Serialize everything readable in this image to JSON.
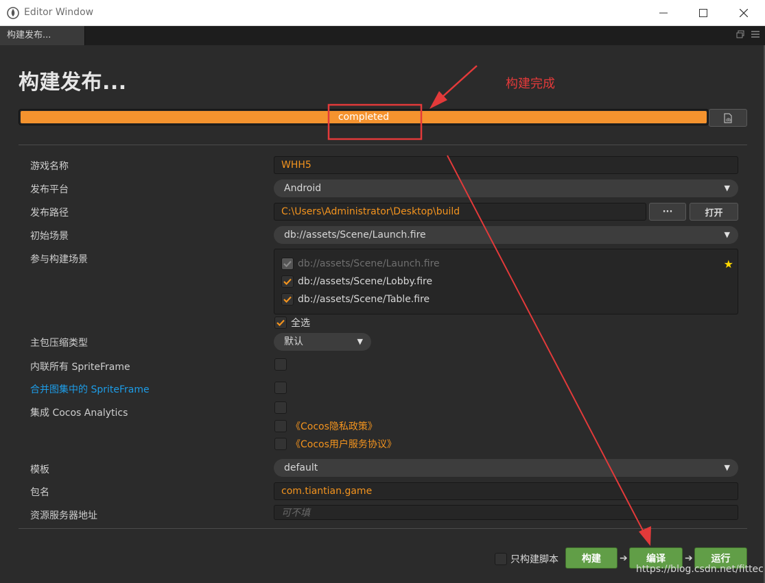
{
  "window": {
    "title": "Editor Window"
  },
  "tab": {
    "label": "构建发布..."
  },
  "page": {
    "heading": "构建发布...",
    "annotation": "构建完成"
  },
  "progress": {
    "label": "completed",
    "percent": 100,
    "color": "#f5932e"
  },
  "form": {
    "game_name": {
      "label": "游戏名称",
      "value": "WHH5"
    },
    "platform": {
      "label": "发布平台",
      "value": "Android"
    },
    "build_path": {
      "label": "发布路径",
      "value": "C:\\Users\\Administrator\\Desktop\\build",
      "browse_label": "···",
      "open_label": "打开"
    },
    "start_scene": {
      "label": "初始场景",
      "value": "db://assets/Scene/Launch.fire"
    },
    "scenes": {
      "label": "参与构建场景",
      "items": [
        {
          "path": "db://assets/Scene/Launch.fire",
          "checked": true,
          "disabled": true
        },
        {
          "path": "db://assets/Scene/Lobby.fire",
          "checked": true,
          "disabled": false
        },
        {
          "path": "db://assets/Scene/Table.fire",
          "checked": true,
          "disabled": false
        }
      ],
      "select_all_label": "全选"
    },
    "compression": {
      "label": "主包压缩类型",
      "value": "默认"
    },
    "inline_spriteframe": {
      "label": "内联所有 SpriteFrame",
      "checked": false
    },
    "merge_spriteframe": {
      "label": "合并图集中的 SpriteFrame",
      "checked": false
    },
    "cocos_analytics": {
      "label": "集成 Cocos Analytics",
      "checked": false,
      "privacy_link": "《Cocos隐私政策》",
      "terms_link": "《Cocos用户服务协议》"
    },
    "template": {
      "label": "模板",
      "value": "default"
    },
    "package_name": {
      "label": "包名",
      "value": "com.tiantian.game"
    },
    "asset_server": {
      "label": "资源服务器地址",
      "placeholder": "可不填"
    }
  },
  "footer": {
    "only_script_label": "只构建脚本",
    "build_label": "构建",
    "compile_label": "编译",
    "run_label": "运行",
    "watermark": "https://blog.csdn.net/fittec"
  },
  "colors": {
    "accent_orange": "#f4941e",
    "button_green": "#619e47",
    "link_blue": "#1d9de8",
    "annotation_red": "#e33a3a"
  }
}
